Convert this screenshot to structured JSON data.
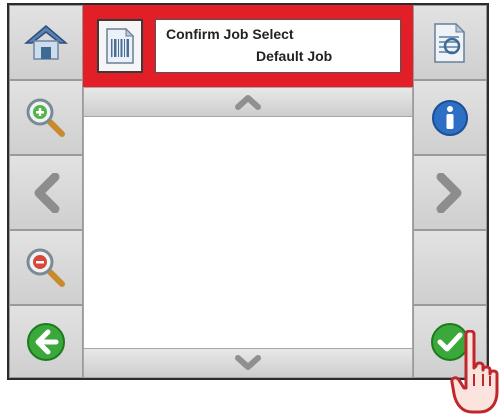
{
  "header": {
    "title_line1": "Confirm Job Select",
    "title_line2": "Default Job",
    "accent_color": "#e21f26"
  },
  "left_toolbar": [
    {
      "name": "home-button",
      "icon": "home-icon"
    },
    {
      "name": "zoom-in-button",
      "icon": "zoom-in-icon"
    },
    {
      "name": "previous-button",
      "icon": "chevron-left-icon"
    },
    {
      "name": "zoom-out-button",
      "icon": "zoom-out-icon"
    },
    {
      "name": "back-button",
      "icon": "green-back-arrow-icon"
    }
  ],
  "right_toolbar": [
    {
      "name": "preview-button",
      "icon": "document-preview-icon"
    },
    {
      "name": "info-button",
      "icon": "info-icon"
    },
    {
      "name": "next-button",
      "icon": "chevron-right-icon"
    },
    {
      "name": "blank-button",
      "icon": ""
    },
    {
      "name": "confirm-button",
      "icon": "green-check-icon"
    }
  ],
  "scroll": {
    "up_icon": "chevron-up-icon",
    "down_icon": "chevron-down-icon"
  },
  "job_list": []
}
